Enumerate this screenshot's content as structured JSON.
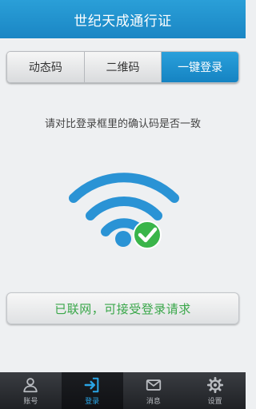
{
  "header": {
    "title": "世纪天成通行证"
  },
  "tabs": [
    {
      "label": "动态码",
      "active": false
    },
    {
      "label": "二维码",
      "active": false
    },
    {
      "label": "一键登录",
      "active": true
    }
  ],
  "instruction": "请对比登录框里的确认码是否一致",
  "wifi": {
    "icon": "wifi-connected-icon",
    "color": "#2a93d5",
    "check_color": "#3ab54a"
  },
  "status": {
    "text": "已联网，可接受登录请求",
    "color": "#3aa74a"
  },
  "bottom_nav": [
    {
      "label": "账号",
      "icon": "person-icon",
      "active": false
    },
    {
      "label": "登录",
      "icon": "login-icon",
      "active": true
    },
    {
      "label": "消息",
      "icon": "mail-icon",
      "active": false
    },
    {
      "label": "设置",
      "icon": "gear-icon",
      "active": false
    }
  ],
  "colors": {
    "accent": "#1a86c4",
    "nav_active": "#2aa5e6"
  }
}
